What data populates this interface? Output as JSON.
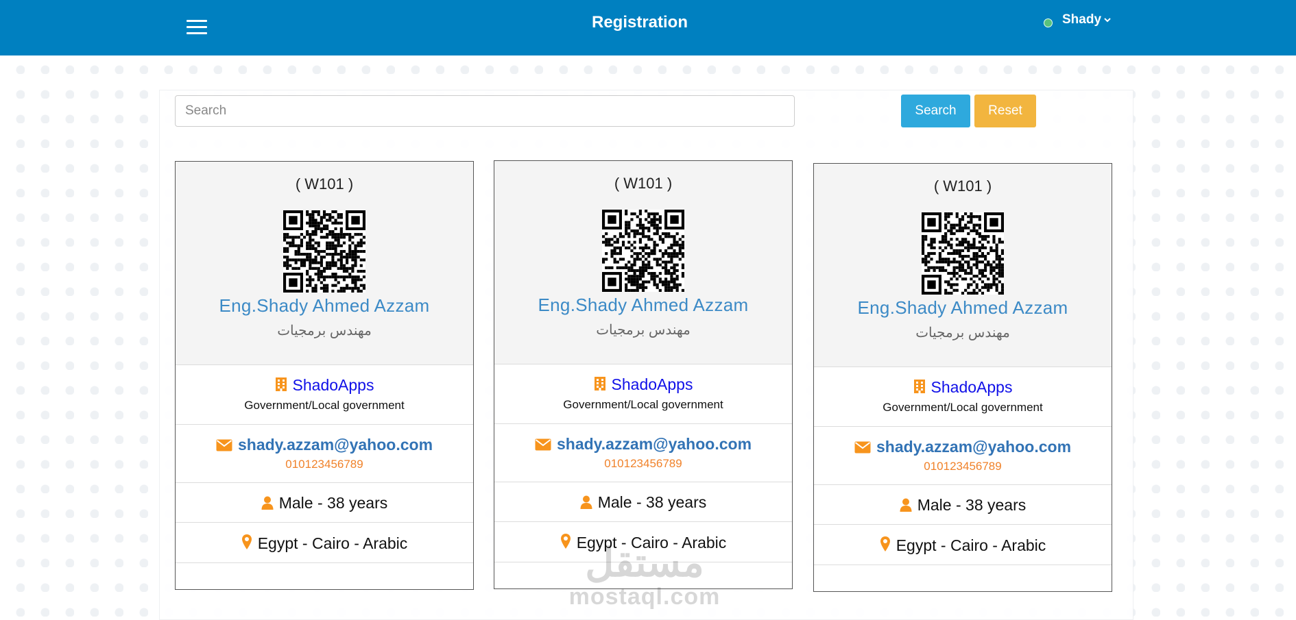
{
  "header": {
    "title": "Registration",
    "user_name": "Shady"
  },
  "search": {
    "placeholder": "Search",
    "search_label": "Search",
    "reset_label": "Reset"
  },
  "cards": [
    {
      "code": "( W101 )",
      "name": "Eng.Shady Ahmed Azzam",
      "job_title": "مهندس برمجيات",
      "company": "ShadoApps",
      "sector": "Government/Local government",
      "email": "shady.azzam@yahoo.com",
      "phone": "010123456789",
      "gender_age": "Male - 38 years",
      "location": "Egypt - Cairo - Arabic"
    },
    {
      "code": "( W101 )",
      "name": "Eng.Shady Ahmed Azzam",
      "job_title": "مهندس برمجيات",
      "company": "ShadoApps",
      "sector": "Government/Local government",
      "email": "shady.azzam@yahoo.com",
      "phone": "010123456789",
      "gender_age": "Male - 38 years",
      "location": "Egypt - Cairo - Arabic"
    },
    {
      "code": "( W101 )",
      "name": "Eng.Shady Ahmed Azzam",
      "job_title": "مهندس برمجيات",
      "company": "ShadoApps",
      "sector": "Government/Local government",
      "email": "shady.azzam@yahoo.com",
      "phone": "010123456789",
      "gender_age": "Male - 38 years",
      "location": "Egypt - Cairo - Arabic"
    }
  ],
  "watermark": {
    "logo": "مستقل",
    "text": "mostaql.com"
  },
  "colors": {
    "header_bg": "#0080c0",
    "search_btn": "#2ea9dd",
    "reset_btn": "#f2b53f",
    "name": "#3c8ac6",
    "company": "#1010e8",
    "icon_orange": "#f7941d",
    "phone": "#f0822a"
  },
  "icons": {
    "menu": "hamburger-icon",
    "status": "online-dot-icon",
    "dropdown": "chevron-down-icon",
    "company": "building-icon",
    "email": "envelope-icon",
    "person": "user-icon",
    "location": "map-marker-icon",
    "qr": "qr-code"
  }
}
